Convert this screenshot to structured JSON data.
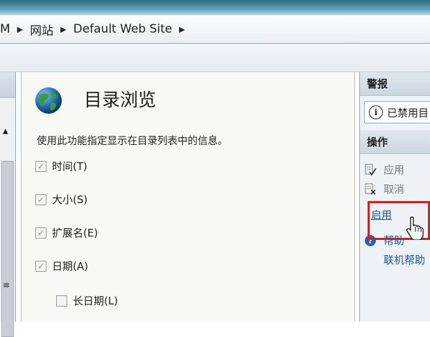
{
  "breadcrumb": {
    "items": [
      "M",
      "网站",
      "Default Web Site"
    ]
  },
  "main": {
    "title": "目录浏览",
    "description": "使用此功能指定显示在目录列表中的信息。",
    "options": [
      {
        "label": "时间(T)",
        "checked": true
      },
      {
        "label": "大小(S)",
        "checked": true
      },
      {
        "label": "扩展名(E)",
        "checked": true
      },
      {
        "label": "日期(A)",
        "checked": true
      },
      {
        "label": "长日期(L)",
        "checked": false
      }
    ]
  },
  "actions_pane": {
    "alerts_header": "警报",
    "alert_text": "已禁用目",
    "actions_header": "操作",
    "apply": "应用",
    "cancel": "取消",
    "enable": "启用",
    "help": "帮助",
    "online_help": "联机帮助"
  },
  "colors": {
    "highlight": "#d21d1d",
    "link": "#1a56a0"
  }
}
